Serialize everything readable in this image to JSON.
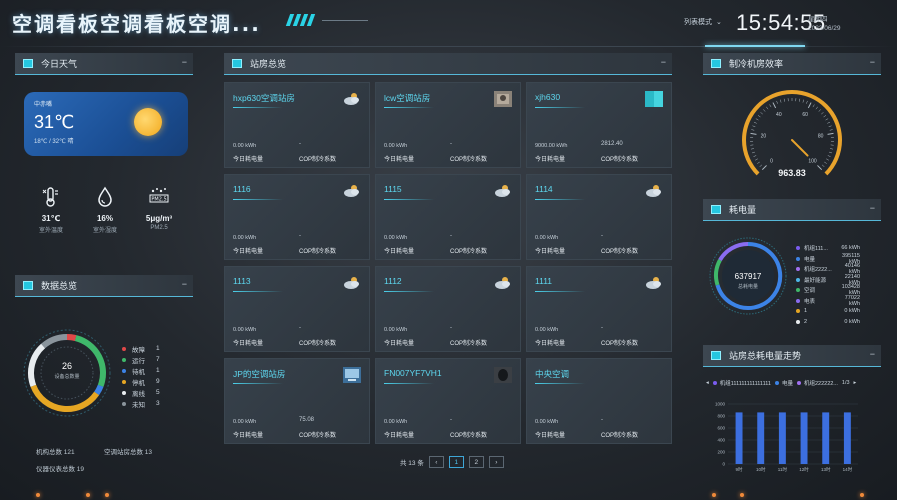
{
  "header": {
    "title": "空调看板空调看板空调...",
    "mode_label": "列表模式",
    "time": "15:54:55",
    "weekday": "星期四",
    "date": "2023/06/29"
  },
  "weather": {
    "panel_title": "今日天气",
    "city": "中赤嘴",
    "temp": "31℃",
    "range": "18℃ / 32℃ 晴",
    "stats": [
      {
        "icon": "thermometer-icon",
        "value": "31℃",
        "label": "室外温度"
      },
      {
        "icon": "humidity-drop-icon",
        "value": "16%",
        "label": "室外湿度"
      },
      {
        "icon": "pm25-icon",
        "value": "5μg/m³",
        "label": "PM2.5"
      }
    ]
  },
  "summary": {
    "panel_title": "数据总览",
    "center_value": "26",
    "center_label": "设备总数量",
    "legend": [
      {
        "label": "故障",
        "value": "1",
        "color": "#e04848"
      },
      {
        "label": "运行",
        "value": "7",
        "color": "#3fb86a"
      },
      {
        "label": "待机",
        "value": "1",
        "color": "#3c83e6"
      },
      {
        "label": "停机",
        "value": "9",
        "color": "#e6a623"
      },
      {
        "label": "离线",
        "value": "5",
        "color": "#e8ecef"
      },
      {
        "label": "未知",
        "value": "3",
        "color": "#8a949c"
      }
    ],
    "footer": [
      {
        "text": "机构总数 121"
      },
      {
        "text": "空调站房总数 13"
      },
      {
        "text": "仪器仪表总数 19"
      }
    ]
  },
  "stations": {
    "panel_title": "站房总览",
    "cards": [
      {
        "name": "hxp630空调站房",
        "kwh": "0.00 kWh",
        "cop": "-",
        "thumb": "weather"
      },
      {
        "name": "lcw空调站房",
        "kwh": "0.00 kWh",
        "cop": "-",
        "thumb": "photo"
      },
      {
        "name": "xjh630",
        "kwh": "9000.00 kWh",
        "cop": "2812.40",
        "thumb": "teal"
      },
      {
        "name": "1116",
        "kwh": "0.00 kWh",
        "cop": "-",
        "thumb": "weather"
      },
      {
        "name": "1115",
        "kwh": "0.00 kWh",
        "cop": "-",
        "thumb": "weather"
      },
      {
        "name": "1114",
        "kwh": "0.00 kWh",
        "cop": "-",
        "thumb": "weather"
      },
      {
        "name": "1113",
        "kwh": "0.00 kWh",
        "cop": "-",
        "thumb": "weather"
      },
      {
        "name": "1112",
        "kwh": "0.00 kWh",
        "cop": "-",
        "thumb": "weather"
      },
      {
        "name": "1111",
        "kwh": "0.00 kWh",
        "cop": "-",
        "thumb": "weather"
      },
      {
        "name": "JP的空调站房",
        "kwh": "0.00 kWh",
        "cop": "75.08",
        "thumb": "screen"
      },
      {
        "name": "FN007YF7VH1",
        "kwh": "0.00 kWh",
        "cop": "-",
        "thumb": "dark"
      },
      {
        "name": "中央空调",
        "kwh": "0.00 kWh",
        "cop": "-",
        "thumb": "none"
      }
    ],
    "kwh_label": "今日耗电量",
    "cop_label": "COP制冷系数",
    "pager": {
      "total": "共 13 条",
      "prev": "‹",
      "pages": [
        "1",
        "2"
      ],
      "next": "›"
    }
  },
  "efficiency": {
    "panel_title": "制冷机房效率",
    "value": "963.83",
    "value_number": 963.83,
    "ticks": [
      "0",
      "20",
      "40",
      "60",
      "80",
      "100"
    ]
  },
  "energy": {
    "panel_title": "耗电量",
    "center_value": "637917",
    "center_label": "总耗电量",
    "items": [
      {
        "label": "机组111...",
        "value": "66 kWh",
        "color": "#7b5cf0"
      },
      {
        "label": "电量",
        "value": "395115 kWh",
        "color": "#3c83e6"
      },
      {
        "label": "机组2222...",
        "value": "40146 kWh",
        "color": "#a070f0"
      },
      {
        "label": "最好能源",
        "value": "22140 kWh",
        "color": "#4db7e8"
      },
      {
        "label": "空调",
        "value": "103428 kWh",
        "color": "#3fb86a"
      },
      {
        "label": "电表",
        "value": "77022 kWh",
        "color": "#8a6cf0"
      },
      {
        "label": "1",
        "value": "0 kWh",
        "color": "#e6a623"
      },
      {
        "label": "2",
        "value": "0 kWh",
        "color": "#e8ecef"
      }
    ]
  },
  "trend": {
    "panel_title": "站房总耗电量走势",
    "legend_items": [
      "机组111111111111111",
      "电量",
      "机组222222..."
    ],
    "legend_colors": [
      "#7b5cf0",
      "#3c83e6",
      "#a070f0"
    ],
    "page": "1/3",
    "chart_data": {
      "type": "bar",
      "categories": [
        "9时",
        "10时",
        "11时",
        "12时",
        "13时",
        "14时"
      ],
      "y_ticks": [
        "1000",
        "800",
        "600",
        "400",
        "200",
        "0"
      ],
      "ylim": [
        0,
        1000
      ],
      "series": [
        {
          "name": "机组111111111111111",
          "values": [
            0,
            0,
            0,
            0,
            0,
            0
          ]
        },
        {
          "name": "电量",
          "values": [
            860,
            860,
            860,
            860,
            860,
            860
          ]
        }
      ]
    }
  }
}
